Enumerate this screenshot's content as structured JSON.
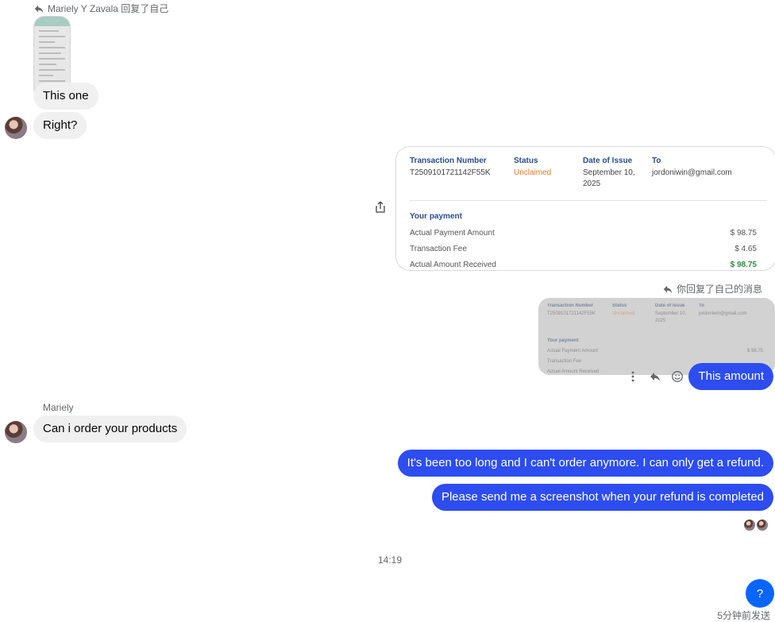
{
  "messages": {
    "reply_header_1": "Mariely Y Zavala 回复了自己",
    "this_one": "This one",
    "right": "Right?",
    "reply_header_2": "你回复了自己的消息",
    "this_amount": "This amount",
    "sender_name": "Mariely",
    "can_order": "Can i order your products",
    "too_long": "It's been too long and I can't order anymore. I can only get a refund.",
    "send_screenshot": "Please send me a screenshot when your refund is completed",
    "timestamp": "14:19",
    "sent_ago": "5分钟前发送",
    "help_label": "?"
  },
  "receipt": {
    "transaction_number_label": "Transaction Number",
    "transaction_number": "T2509101721142F55K",
    "status_label": "Status",
    "status": "Unclaimed",
    "date_label": "Date of Issue",
    "date_line1": "September 10,",
    "date_line2": "2025",
    "to_label": "To",
    "to": "jordoniwin@gmail.com",
    "your_payment": "Your payment",
    "actual_payment_label": "Actual Payment Amount",
    "actual_payment": "$ 98.75",
    "fee_label": "Transaction Fee",
    "fee": "$ 4.65",
    "received_label": "Actual Amount Received",
    "received": "$ 98.75"
  },
  "colors": {
    "outgoing": "#2d4df0",
    "incoming": "#f0f0f0",
    "status_orange": "#e8772e",
    "received_green": "#2e8b3e",
    "header_blue": "#2b4c8e"
  },
  "icons": [
    "reply-icon",
    "share-icon",
    "more-icon",
    "emoji-icon"
  ]
}
